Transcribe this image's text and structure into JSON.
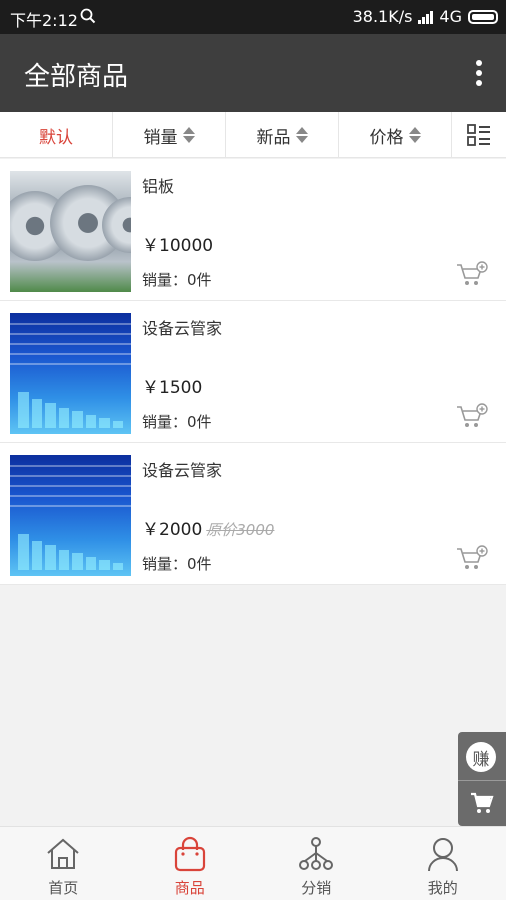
{
  "status_bar": {
    "time": "下午2:12",
    "network_speed": "38.1K/s",
    "network_type": "4G"
  },
  "header": {
    "title": "全部商品"
  },
  "sort_bar": {
    "items": [
      "默认",
      "销量",
      "新品",
      "价格"
    ]
  },
  "products": [
    {
      "name": "铝板",
      "price": "￥10000",
      "original_price": "",
      "sales": "销量：0件"
    },
    {
      "name": "设备云管家",
      "price": "￥1500",
      "original_price": "",
      "sales": "销量：0件"
    },
    {
      "name": "设备云管家",
      "price": "￥2000",
      "original_price": "原价3000",
      "sales": "销量：0件"
    }
  ],
  "float_side": {
    "earn_label": "赚"
  },
  "tabbar": {
    "items": [
      "首页",
      "商品",
      "分销",
      "我的"
    ],
    "active": "商品"
  },
  "colors": {
    "accent": "#d9443a",
    "header_bg": "#3e3e3e",
    "status_bg": "#1c1c1c"
  }
}
